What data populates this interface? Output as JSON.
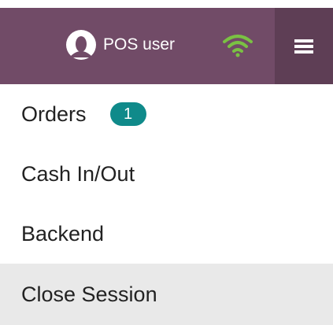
{
  "header": {
    "user_name": "POS user",
    "colors": {
      "bar": "#714b67",
      "toggle": "#5e3e55",
      "wifi": "#7ac143"
    }
  },
  "menu": {
    "items": [
      {
        "label": "Orders",
        "badge": "1"
      },
      {
        "label": "Cash In/Out"
      },
      {
        "label": "Backend"
      },
      {
        "label": "Close Session"
      }
    ]
  }
}
